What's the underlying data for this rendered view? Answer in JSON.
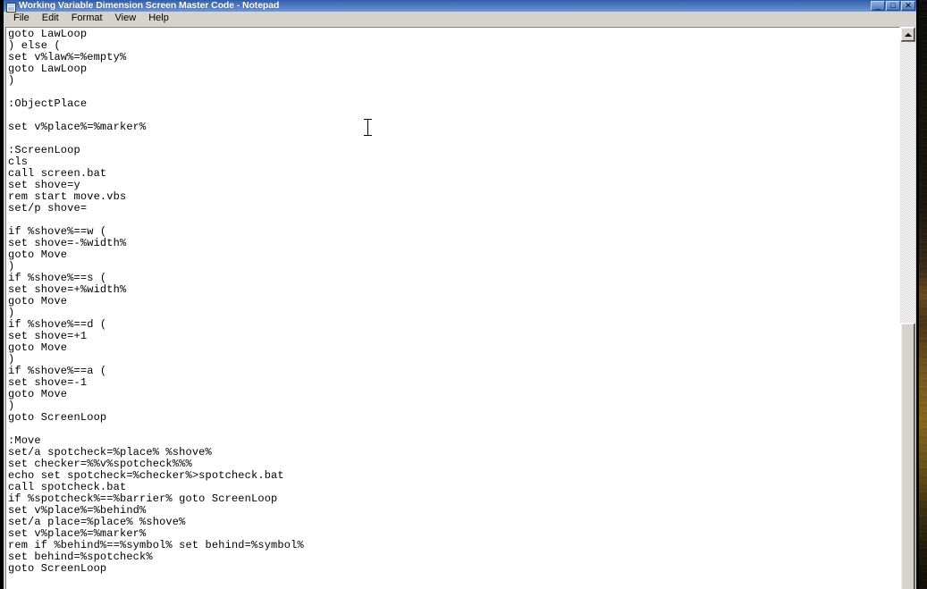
{
  "window": {
    "title": "Working Variable Dimension Screen Master Code - Notepad",
    "icon": "notepad-document-icon",
    "controls": {
      "minimize_label": "_",
      "maximize_label": "□",
      "close_label": "✕"
    }
  },
  "menu": {
    "items": [
      {
        "label": "File"
      },
      {
        "label": "Edit"
      },
      {
        "label": "Format"
      },
      {
        "label": "View"
      },
      {
        "label": "Help"
      }
    ]
  },
  "editor": {
    "text": "goto LawLoop\n) else (\nset v%law%=%empty%\ngoto LawLoop\n)\n\n:ObjectPlace\n\nset v%place%=%marker%\n\n:ScreenLoop\ncls\ncall screen.bat\nset shove=y\nrem start move.vbs\nset/p shove=\n\nif %shove%==w (\nset shove=-%width%\ngoto Move\n)\nif %shove%==s (\nset shove=+%width%\ngoto Move\n)\nif %shove%==d (\nset shove=+1\ngoto Move\n)\nif %shove%==a (\nset shove=-1\ngoto Move\n)\ngoto ScreenLoop\n\n:Move\nset/a spotcheck=%place% %shove%\nset checker=%%v%spotcheck%%%\necho set spotcheck=%checker%>spotcheck.bat\ncall spotcheck.bat\nif %spotcheck%==%barrier% goto ScreenLoop\nset v%place%=%behind%\nset/a place=%place% %shove%\nset v%place%=%marker%\nrem if %behind%==%symbol% set behind=%symbol%\nset behind=%spotcheck%\ngoto ScreenLoop"
  },
  "scrollbar": {
    "up_arrow": "scroll-up-arrow-icon",
    "orientation": "vertical"
  },
  "colors": {
    "titlebar_start": "#2f5ba8",
    "titlebar_end": "#7396d2",
    "window_face": "#d6d3ce",
    "editor_bg": "#ffffff",
    "editor_text": "#000000"
  }
}
